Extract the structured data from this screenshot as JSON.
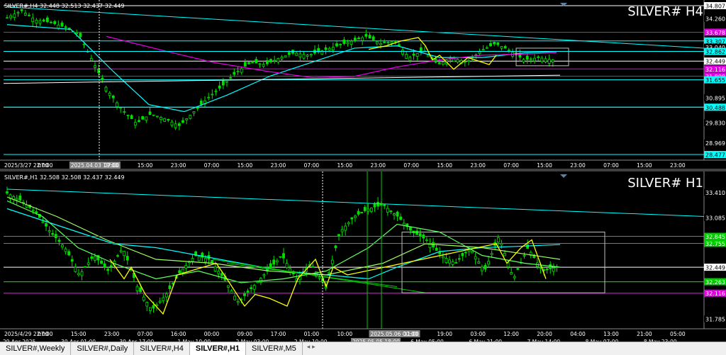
{
  "top_pane": {
    "header": "SILVER#,H4  32.448 32.513 32.437 32.449",
    "title": "SILVER# H4",
    "price_labels": [
      {
        "text": "34.807",
        "y": 34.807,
        "bg": "#ffffff",
        "fg": "#000000"
      },
      {
        "text": "34.260",
        "y": 34.26,
        "bg": "#000000",
        "fg": "#ffffff"
      },
      {
        "text": "33.678",
        "y": 33.678,
        "bg": "#e000e0",
        "fg": "#ffffff"
      },
      {
        "text": "33.307",
        "y": 33.307,
        "bg": "#00ffff",
        "fg": "#000000"
      },
      {
        "text": "33.040",
        "y": 33.04,
        "bg": "#000000",
        "fg": "#ffffff"
      },
      {
        "text": "32.862",
        "y": 32.862,
        "bg": "#00ffff",
        "fg": "#000000"
      },
      {
        "text": "32.449",
        "y": 32.449,
        "bg": "#ffffff",
        "fg": "#000000"
      },
      {
        "text": "32.116",
        "y": 32.116,
        "bg": "#e000e0",
        "fg": "#ffffff"
      },
      {
        "text": "31.808",
        "y": 31.808,
        "bg": "#e000e0",
        "fg": "#ffffff"
      },
      {
        "text": "31.655",
        "y": 31.655,
        "bg": "#00ffff",
        "fg": "#000000"
      },
      {
        "text": "30.895",
        "y": 30.895,
        "bg": "#000000",
        "fg": "#ffffff"
      },
      {
        "text": "30.488",
        "y": 30.488,
        "bg": "#00ffff",
        "fg": "#000000"
      },
      {
        "text": "29.830",
        "y": 29.83,
        "bg": "#000000",
        "fg": "#ffffff"
      },
      {
        "text": "28.969",
        "y": 28.969,
        "bg": "#000000",
        "fg": "#ffffff"
      },
      {
        "text": "28.477",
        "y": 28.477,
        "bg": "#00ffff",
        "fg": "#000000"
      }
    ],
    "time_row1": [
      "2025/3/27 22:00",
      "07:00",
      "2025.04.03 19:00",
      "07:00",
      "15:00",
      "23:00",
      "07:00",
      "15:00",
      "23:00",
      "07:00",
      "15:00",
      "23:00",
      "07:00",
      "15:00",
      "23:00",
      "07:00",
      "15:00",
      "23:00",
      "07:00",
      "15:00",
      "23:00"
    ],
    "time_row2": [
      "27 Mar 2025",
      "1 Apr 01:",
      "2025.04.03 13:00",
      "8 Apr 09:00",
      "11 Apr 01:00",
      "15 Apr 17:00",
      "21 Apr 09:00",
      "24 Apr 01:00",
      "28 Apr 17:00",
      "1 May 09:00",
      "6 May 01:00",
      "8 May 17:00"
    ]
  },
  "bottom_pane": {
    "header": "SILVER#,H1  32.508 32.508 32.437 32.449",
    "title": "SILVER# H1",
    "price_labels": [
      {
        "text": "33.410",
        "y": 33.41,
        "bg": "#000000",
        "fg": "#ffffff"
      },
      {
        "text": "33.085",
        "y": 33.085,
        "bg": "#000000",
        "fg": "#ffffff"
      },
      {
        "text": "32.845",
        "y": 32.845,
        "bg": "#00cc00",
        "fg": "#ffffff"
      },
      {
        "text": "32.755",
        "y": 32.755,
        "bg": "#00cc00",
        "fg": "#ffffff"
      },
      {
        "text": "32.449",
        "y": 32.449,
        "bg": "#ffffff",
        "fg": "#000000"
      },
      {
        "text": "32.263",
        "y": 32.263,
        "bg": "#00cc00",
        "fg": "#ffffff"
      },
      {
        "text": "32.116",
        "y": 32.116,
        "bg": "#e000e0",
        "fg": "#ffffff"
      },
      {
        "text": "31.785",
        "y": 31.785,
        "bg": "#000000",
        "fg": "#ffffff"
      }
    ],
    "time_row1": [
      "2025/4/29 22:00",
      "07:00",
      "15:00",
      "23:00",
      "07:00",
      "16:00",
      "00:00",
      "09:00",
      "17:00",
      "01:00",
      "10:00",
      "2025.05.06 00:00",
      "11:00",
      "19:00",
      "03:00",
      "12:00",
      "20:00",
      "04:00",
      "13:00",
      "21:00",
      "05:00"
    ],
    "time_row2": [
      "29 Apr 2025",
      "30 Apr 01:00",
      "30 Apr 17:00",
      "1 May 10:00",
      "2 May 03:00",
      "2 May 19:00",
      "2025.05.05 18:00",
      "6 May 05:00",
      "6 May 21:00",
      "7 May 14:00",
      "8 May 07:00",
      "8 May 23:00"
    ]
  },
  "tabs": [
    "SILVER#,Weekly",
    "SILVER#,Daily",
    "SILVER#,H4",
    "SILVER#,H1",
    "SILVER#,M5"
  ],
  "active_tab": "SILVER#,H1",
  "colors": {
    "cyan": "#00ffff",
    "magenta": "#e000e0",
    "yellow": "#ffff00",
    "green": "#00cc00",
    "red": "#ff0000",
    "white": "#ffffff"
  }
}
